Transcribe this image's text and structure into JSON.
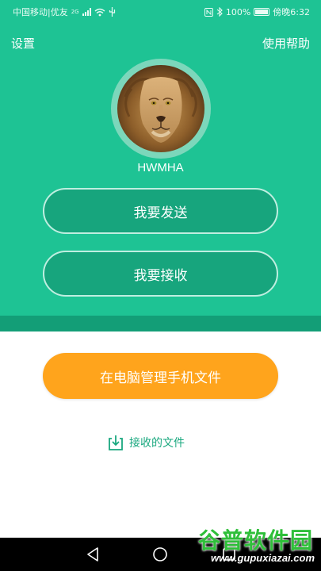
{
  "status_bar": {
    "carrier": "中国移动|优友",
    "network_badge": "2G",
    "battery_text": "100%",
    "time_text": "傍晚6:32",
    "icons": [
      "signal-icon",
      "wifi-icon",
      "usb-icon",
      "nfc-icon",
      "bluetooth-icon",
      "battery-icon"
    ]
  },
  "header": {
    "settings_label": "设置",
    "help_label": "使用帮助"
  },
  "profile": {
    "avatar": "lion-avatar",
    "username": "HWMHA"
  },
  "actions": {
    "send_label": "我要发送",
    "receive_label": "我要接收",
    "pc_manage_label": "在电脑管理手机文件"
  },
  "received_files": {
    "icon": "download-tray-icon",
    "label": "接收的文件"
  },
  "nav_bar": {
    "buttons": [
      "back-icon",
      "home-icon",
      "recents-icon"
    ]
  },
  "watermark": {
    "main_text": "谷普软件园",
    "url_text": "www.gupuxiazai.com"
  },
  "colors": {
    "primary_green": "#1ec394",
    "dark_green": "#17a57d",
    "strip_green": "#139e77",
    "orange": "#ffa41c",
    "link_green": "#1aa87f",
    "watermark_green": "#2fbf3a"
  }
}
